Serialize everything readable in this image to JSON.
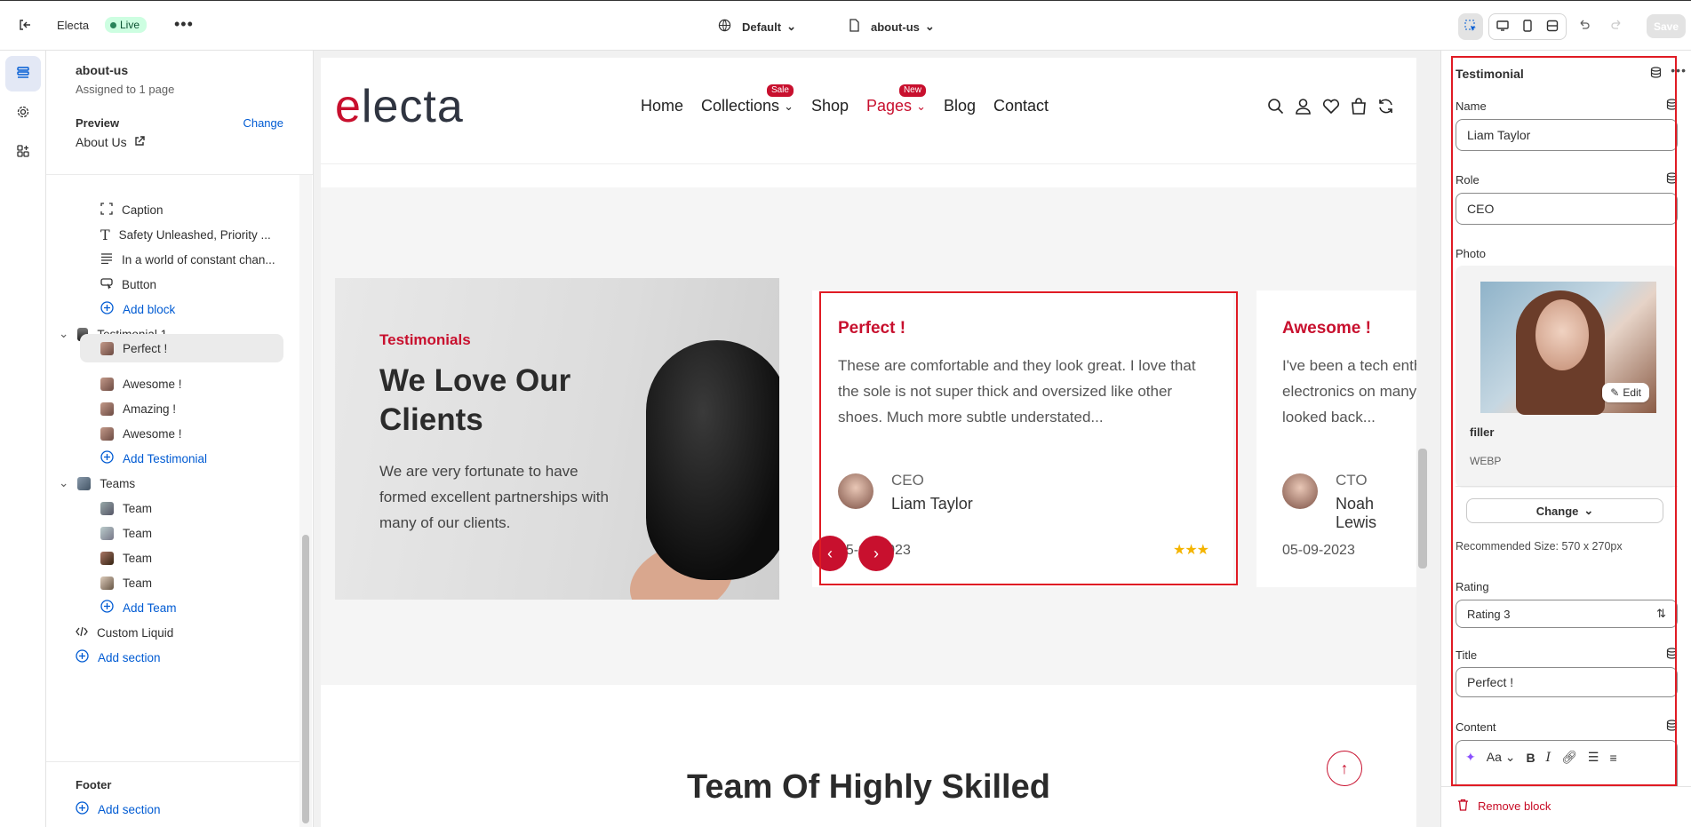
{
  "topbar": {
    "store_name": "Electa",
    "live_label": "Live",
    "theme_select": "Default",
    "template_select": "about-us",
    "save_label": "Save"
  },
  "left": {
    "template_title": "about-us",
    "template_sub": "Assigned to 1 page",
    "preview_label": "Preview",
    "change_label": "Change",
    "preview_page": "About Us",
    "items": {
      "caption": "Caption",
      "safety": "Safety Unleashed, Priority ...",
      "world": "In a world of constant chan...",
      "button": "Button",
      "add_block": "Add block",
      "testimonial1": "Testimonial 1",
      "t_perfect": "Perfect !",
      "t_awesome1": "Awesome !",
      "t_amazing": "Amazing !",
      "t_awesome2": "Awesome !",
      "add_testimonial": "Add Testimonial",
      "teams": "Teams",
      "team1": "Team",
      "team2": "Team",
      "team3": "Team",
      "team4": "Team",
      "add_team": "Add Team",
      "custom_liquid": "Custom Liquid",
      "add_section": "Add section"
    },
    "footer_label": "Footer",
    "footer_add_section": "Add section"
  },
  "site": {
    "logo_e": "e",
    "logo_rest": "lecta",
    "menu": {
      "home": "Home",
      "collections": "Collections",
      "collections_badge": "Sale",
      "shop": "Shop",
      "pages": "Pages",
      "pages_badge": "New",
      "blog": "Blog",
      "contact": "Contact"
    },
    "hero": {
      "kicker": "Testimonials",
      "heading": "We Love Our Clients",
      "desc": "We are very fortunate to have formed excellent partnerships with many of our clients."
    },
    "cards": [
      {
        "title": "Perfect !",
        "body": "These are comfortable and they look great. I love that the sole is not super thick and oversized like other shoes. Much more subtle understated...",
        "role": "CEO",
        "name": "Liam Taylor",
        "date": "05-09-2023",
        "stars": "★★★"
      },
      {
        "title": "Awesome !",
        "body": "I've been a tech enthusiast and have shopped for electronics on many websites. But every time I haven't looked back...",
        "role": "CTO",
        "name": "Noah Lewis",
        "date": "05-09-2023",
        "stars": ""
      }
    ],
    "team_heading": "Team Of Highly Skilled"
  },
  "right": {
    "header": "Testimonial",
    "name_label": "Name",
    "name_value": "Liam Taylor",
    "role_label": "Role",
    "role_value": "CEO",
    "photo_label": "Photo",
    "edit_label": "Edit",
    "file_name": "filler",
    "file_type": "WEBP",
    "change_label": "Change",
    "recommended": "Recommended Size: 570 x 270px",
    "rating_label": "Rating",
    "rating_value": "Rating 3",
    "title_label": "Title",
    "title_value": "Perfect !",
    "content_label": "Content",
    "remove_label": "Remove block"
  },
  "colors": {
    "accent": "#c8102e",
    "link": "#005bd3",
    "highlight": "#e01b24"
  }
}
